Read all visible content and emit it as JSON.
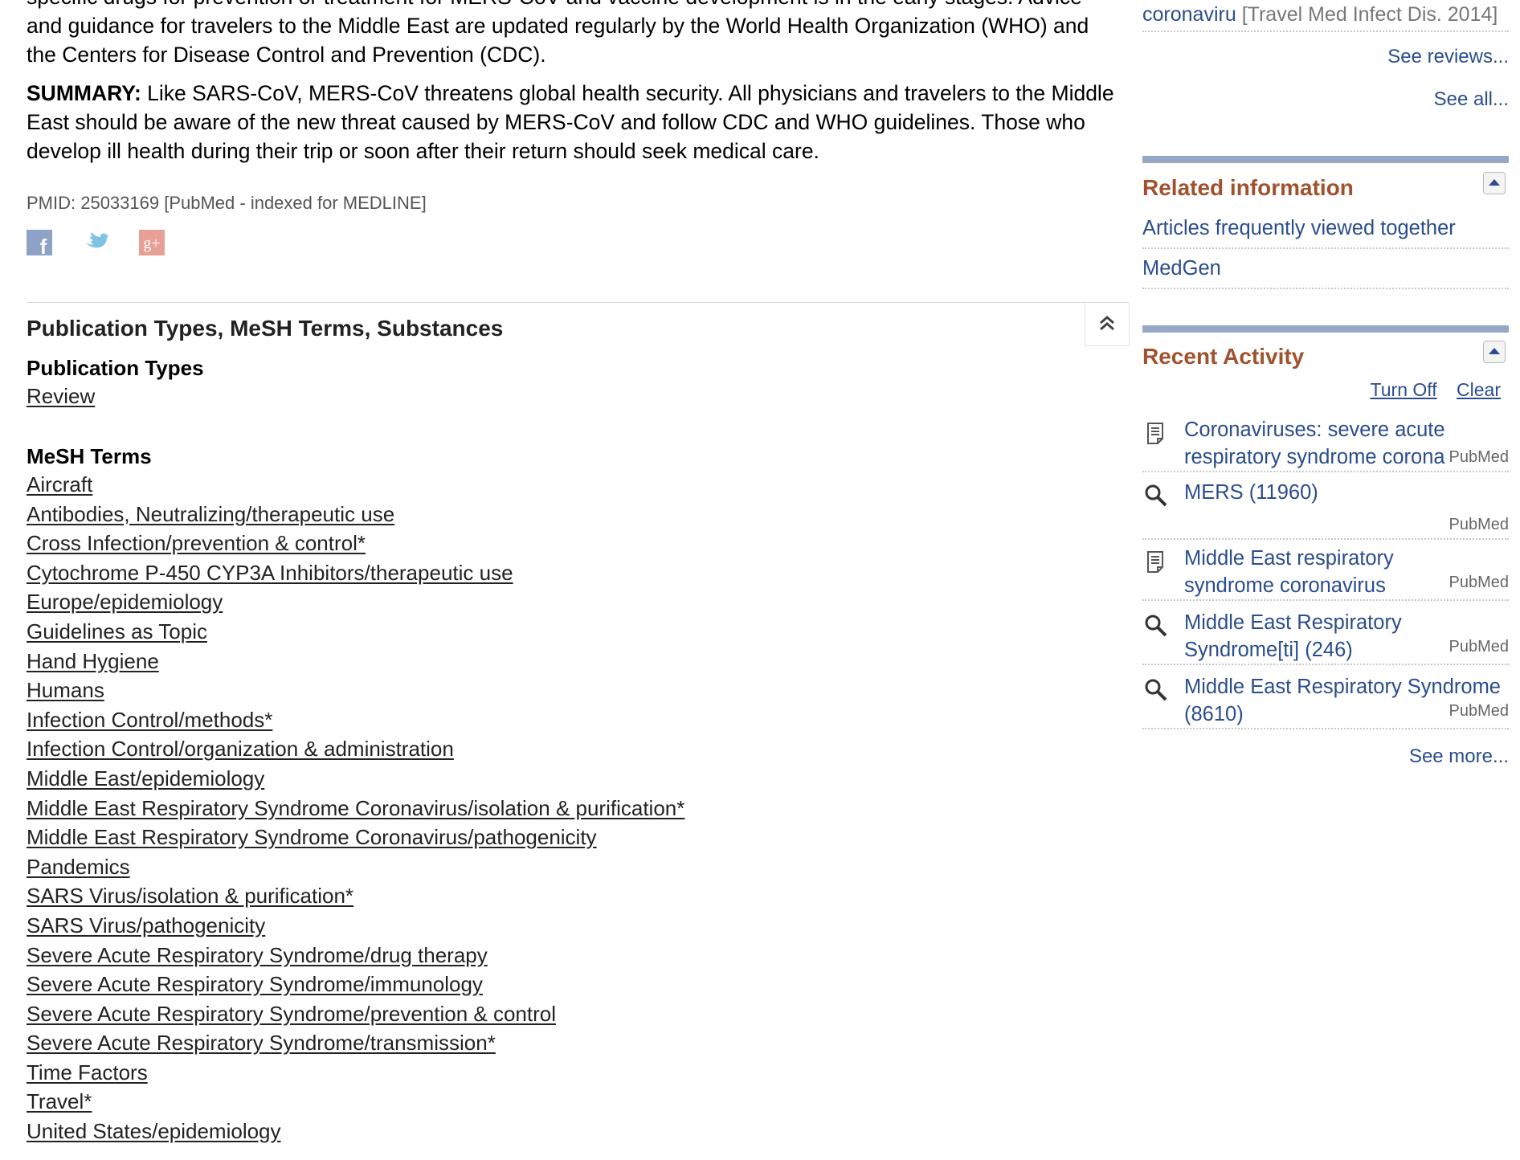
{
  "abstract": {
    "tail_text": "specific drugs for prevention or treatment for MERS-CoV and vaccine development is in the early stages. Advice and guidance for travelers to the Middle East are updated regularly by the World Health Organization (WHO) and the Centers for Disease Control and Prevention (CDC).",
    "summary_label": "SUMMARY:",
    "summary_text": " Like SARS-CoV, MERS-CoV threatens global health security. All physicians and travelers to the Middle East should be aware of the new threat caused by MERS-CoV and follow CDC and WHO guidelines. Those who develop ill health during their trip or soon after their return should seek medical care."
  },
  "pmid_line": "PMID: 25033169 [PubMed - indexed for MEDLINE]",
  "social": {
    "facebook": "f",
    "googleplus": "g+"
  },
  "section": {
    "title": "Publication Types, MeSH Terms, Substances",
    "pub_types_heading": "Publication Types",
    "pub_types": [
      "Review"
    ],
    "mesh_heading": "MeSH Terms",
    "mesh_terms": [
      "Aircraft",
      "Antibodies, Neutralizing/therapeutic use",
      "Cross Infection/prevention & control*",
      "Cytochrome P-450 CYP3A Inhibitors/therapeutic use",
      "Europe/epidemiology",
      "Guidelines as Topic",
      "Hand Hygiene",
      "Humans",
      "Infection Control/methods*",
      "Infection Control/organization & administration",
      "Middle East/epidemiology",
      "Middle East Respiratory Syndrome Coronavirus/isolation & purification*",
      "Middle East Respiratory Syndrome Coronavirus/pathogenicity",
      "Pandemics",
      "SARS Virus/isolation & purification*",
      "SARS Virus/pathogenicity",
      "Severe Acute Respiratory Syndrome/drug therapy",
      "Severe Acute Respiratory Syndrome/immunology",
      "Severe Acute Respiratory Syndrome/prevention & control",
      "Severe Acute Respiratory Syndrome/transmission*",
      "Time Factors",
      "Travel*",
      "United States/epidemiology"
    ]
  },
  "sidebar": {
    "reference": {
      "link": "coronaviru",
      "source": "[Travel Med Infect Dis. 2014]"
    },
    "see_reviews": "See reviews...",
    "see_all": "See all...",
    "related": {
      "title": "Related information",
      "items": [
        "Articles frequently viewed together",
        "MedGen"
      ]
    },
    "recent": {
      "title": "Recent Activity",
      "turn_off": "Turn Off",
      "clear": "Clear",
      "items": [
        {
          "type": "doc-icon",
          "text": "Coronaviruses: severe acute respiratory syndrome corona",
          "source": "PubMed"
        },
        {
          "type": "search-icon",
          "text": "MERS (11960)",
          "source": "PubMed"
        },
        {
          "type": "doc-icon",
          "text": "Middle East respiratory syndrome coronavirus (MERS-CoV):",
          "source": "PubMed"
        },
        {
          "type": "search-icon",
          "text": "Middle East Respiratory Syndrome[ti] (246)",
          "source": "PubMed"
        },
        {
          "type": "search-icon",
          "text": "Middle East Respiratory Syndrome (8610)",
          "source": "PubMed"
        }
      ],
      "see_more": "See more..."
    }
  },
  "colors": {
    "link_blue": "#2a4d8f",
    "portlet_title": "#a0522d",
    "portlet_bar": "#96a8c5"
  }
}
